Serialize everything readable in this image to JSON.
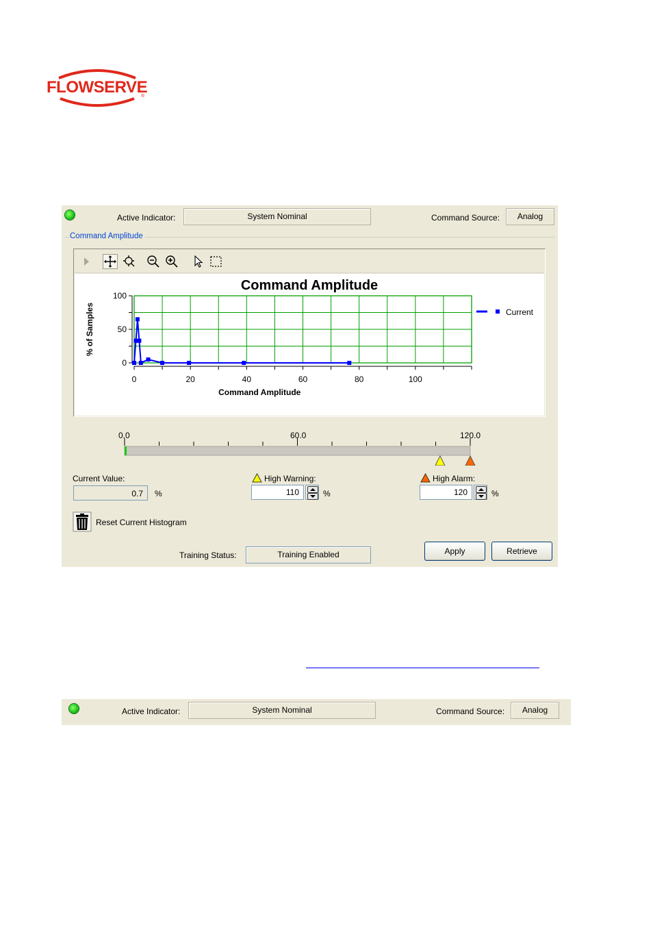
{
  "logo": {
    "text": "FLOWSERVE",
    "trademark": "®"
  },
  "status": {
    "active_indicator_label": "Active Indicator:",
    "active_indicator_value": "System Nominal",
    "command_source_label": "Command Source:",
    "command_source_value": "Analog"
  },
  "group_title": "Command Amplitude",
  "toolbar_icons": [
    "play-icon",
    "pan-icon",
    "zoom-fit-icon",
    "zoom-out-icon",
    "zoom-in-icon",
    "select-icon",
    "rect-select-icon"
  ],
  "chart_data": {
    "type": "line",
    "title": "Command Amplitude",
    "xlabel": "Command Amplitude",
    "ylabel": "% of Samples",
    "xlim": [
      0,
      120
    ],
    "ylim": [
      0,
      100
    ],
    "x_ticks": [
      0,
      20,
      40,
      60,
      80,
      100
    ],
    "y_ticks": [
      0,
      50,
      100
    ],
    "grid": true,
    "legend_position": "right",
    "series": [
      {
        "name": "Current",
        "color": "#0000ff",
        "points": [
          [
            0,
            0
          ],
          [
            0.6,
            33
          ],
          [
            1.2,
            65
          ],
          [
            1.8,
            33
          ],
          [
            2.4,
            0
          ],
          [
            5,
            5
          ],
          [
            10,
            0
          ],
          [
            19.5,
            0
          ],
          [
            39,
            0
          ],
          [
            76.5,
            0
          ]
        ]
      }
    ]
  },
  "scale": {
    "min_label": "0.0",
    "mid_label": "60.0",
    "max_label": "120.0",
    "min": 0,
    "max": 120,
    "warning_marker": 110,
    "alarm_marker": 120,
    "current_fill": 0.7
  },
  "current_value": {
    "label": "Current Value:",
    "value": "0.7",
    "unit": "%"
  },
  "high_warning": {
    "label": "High Warning:",
    "value": "110",
    "unit": "%"
  },
  "high_alarm": {
    "label": "High Alarm:",
    "value": "120",
    "unit": "%"
  },
  "reset_label": "Reset Current Histogram",
  "training": {
    "label": "Training Status:",
    "value": "Training Enabled"
  },
  "buttons": {
    "apply": "Apply",
    "retrieve": "Retrieve"
  },
  "colors": {
    "warning": "#ffff00",
    "alarm": "#ff6600",
    "led": "#1ec81e",
    "grid": "#00a000",
    "series": "#0000ff"
  },
  "status2": {
    "active_indicator_label": "Active Indicator:",
    "active_indicator_value": "System Nominal",
    "command_source_label": "Command Source:",
    "command_source_value": "Analog"
  }
}
